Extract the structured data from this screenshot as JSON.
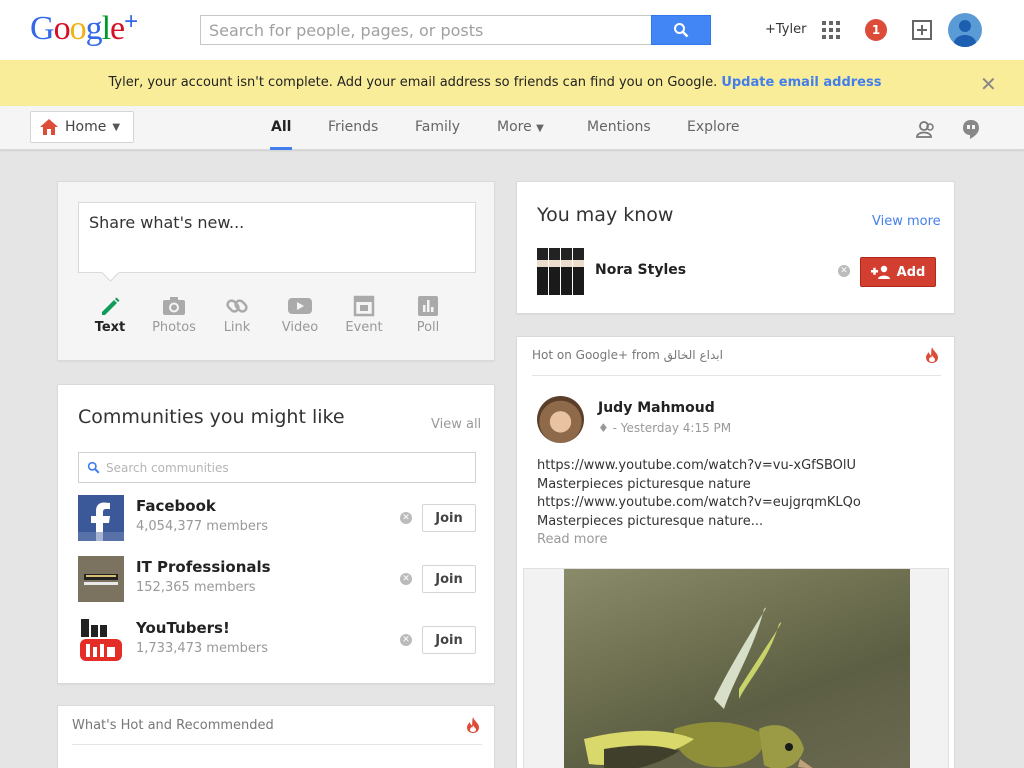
{
  "header": {
    "logo_text": "Google+",
    "search_placeholder": "Search for people, pages, or posts",
    "user_label": "+Tyler",
    "notification_count": "1"
  },
  "banner": {
    "message": "Tyler, your account isn't complete. Add your email address so friends can find you on Google.",
    "link": "Update email address",
    "close": "✕"
  },
  "nav": {
    "home_label": "Home",
    "tabs": [
      {
        "label": "All",
        "active": true
      },
      {
        "label": "Friends"
      },
      {
        "label": "Family"
      },
      {
        "label": "More"
      },
      {
        "label": "Mentions"
      },
      {
        "label": "Explore"
      }
    ]
  },
  "share": {
    "placeholder": "Share what's new...",
    "options": [
      "Text",
      "Photos",
      "Link",
      "Video",
      "Event",
      "Poll"
    ]
  },
  "communities": {
    "title": "Communities you might like",
    "view_all": "View all",
    "search_placeholder": "Search communities",
    "join_label": "Join",
    "items": [
      {
        "name": "Facebook",
        "members": "4,054,377 members"
      },
      {
        "name": "IT Professionals",
        "members": "152,365 members"
      },
      {
        "name": "YouTubers!",
        "members": "1,733,473 members"
      }
    ]
  },
  "hot_recommended": {
    "title": "What's Hot and Recommended"
  },
  "you_may_know": {
    "title": "You may know",
    "view_more": "View more",
    "person": "Nora Styles",
    "add_label": "Add"
  },
  "post": {
    "hot_label": "Hot on Google+ from ابداع الخالق",
    "author": "Judy Mahmoud",
    "meta": "♦  -  Yesterday 4:15 PM",
    "lines": [
      "https://www.youtube.com/watch?v=vu-xGfSBOlU",
      "Masterpieces picturesque nature",
      "https://www.youtube.com/watch?v=eujgrqmKLQo",
      "Masterpieces picturesque nature..."
    ],
    "read_more": "Read more"
  },
  "colors": {
    "banner_bg": "#f9ed9a",
    "link_blue": "#427fed",
    "add_red": "#d23f31",
    "notif_red": "#dd4b39",
    "search_blue": "#4285f4"
  }
}
